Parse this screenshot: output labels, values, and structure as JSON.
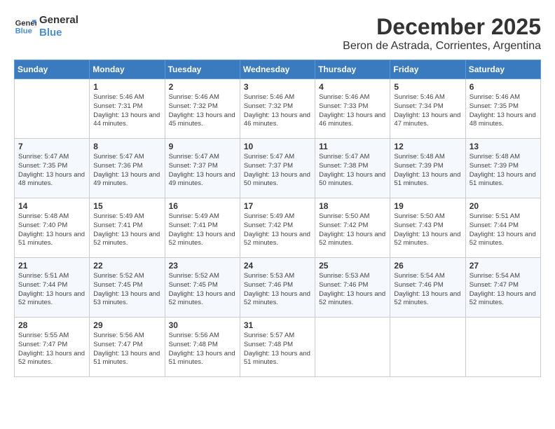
{
  "header": {
    "logo_line1": "General",
    "logo_line2": "Blue",
    "month": "December 2025",
    "location": "Beron de Astrada, Corrientes, Argentina"
  },
  "weekdays": [
    "Sunday",
    "Monday",
    "Tuesday",
    "Wednesday",
    "Thursday",
    "Friday",
    "Saturday"
  ],
  "weeks": [
    [
      {
        "day": "",
        "sunrise": "",
        "sunset": "",
        "daylight": ""
      },
      {
        "day": "1",
        "sunrise": "Sunrise: 5:46 AM",
        "sunset": "Sunset: 7:31 PM",
        "daylight": "Daylight: 13 hours and 44 minutes."
      },
      {
        "day": "2",
        "sunrise": "Sunrise: 5:46 AM",
        "sunset": "Sunset: 7:32 PM",
        "daylight": "Daylight: 13 hours and 45 minutes."
      },
      {
        "day": "3",
        "sunrise": "Sunrise: 5:46 AM",
        "sunset": "Sunset: 7:32 PM",
        "daylight": "Daylight: 13 hours and 46 minutes."
      },
      {
        "day": "4",
        "sunrise": "Sunrise: 5:46 AM",
        "sunset": "Sunset: 7:33 PM",
        "daylight": "Daylight: 13 hours and 46 minutes."
      },
      {
        "day": "5",
        "sunrise": "Sunrise: 5:46 AM",
        "sunset": "Sunset: 7:34 PM",
        "daylight": "Daylight: 13 hours and 47 minutes."
      },
      {
        "day": "6",
        "sunrise": "Sunrise: 5:46 AM",
        "sunset": "Sunset: 7:35 PM",
        "daylight": "Daylight: 13 hours and 48 minutes."
      }
    ],
    [
      {
        "day": "7",
        "sunrise": "Sunrise: 5:47 AM",
        "sunset": "Sunset: 7:35 PM",
        "daylight": "Daylight: 13 hours and 48 minutes."
      },
      {
        "day": "8",
        "sunrise": "Sunrise: 5:47 AM",
        "sunset": "Sunset: 7:36 PM",
        "daylight": "Daylight: 13 hours and 49 minutes."
      },
      {
        "day": "9",
        "sunrise": "Sunrise: 5:47 AM",
        "sunset": "Sunset: 7:37 PM",
        "daylight": "Daylight: 13 hours and 49 minutes."
      },
      {
        "day": "10",
        "sunrise": "Sunrise: 5:47 AM",
        "sunset": "Sunset: 7:37 PM",
        "daylight": "Daylight: 13 hours and 50 minutes."
      },
      {
        "day": "11",
        "sunrise": "Sunrise: 5:47 AM",
        "sunset": "Sunset: 7:38 PM",
        "daylight": "Daylight: 13 hours and 50 minutes."
      },
      {
        "day": "12",
        "sunrise": "Sunrise: 5:48 AM",
        "sunset": "Sunset: 7:39 PM",
        "daylight": "Daylight: 13 hours and 51 minutes."
      },
      {
        "day": "13",
        "sunrise": "Sunrise: 5:48 AM",
        "sunset": "Sunset: 7:39 PM",
        "daylight": "Daylight: 13 hours and 51 minutes."
      }
    ],
    [
      {
        "day": "14",
        "sunrise": "Sunrise: 5:48 AM",
        "sunset": "Sunset: 7:40 PM",
        "daylight": "Daylight: 13 hours and 51 minutes."
      },
      {
        "day": "15",
        "sunrise": "Sunrise: 5:49 AM",
        "sunset": "Sunset: 7:41 PM",
        "daylight": "Daylight: 13 hours and 52 minutes."
      },
      {
        "day": "16",
        "sunrise": "Sunrise: 5:49 AM",
        "sunset": "Sunset: 7:41 PM",
        "daylight": "Daylight: 13 hours and 52 minutes."
      },
      {
        "day": "17",
        "sunrise": "Sunrise: 5:49 AM",
        "sunset": "Sunset: 7:42 PM",
        "daylight": "Daylight: 13 hours and 52 minutes."
      },
      {
        "day": "18",
        "sunrise": "Sunrise: 5:50 AM",
        "sunset": "Sunset: 7:42 PM",
        "daylight": "Daylight: 13 hours and 52 minutes."
      },
      {
        "day": "19",
        "sunrise": "Sunrise: 5:50 AM",
        "sunset": "Sunset: 7:43 PM",
        "daylight": "Daylight: 13 hours and 52 minutes."
      },
      {
        "day": "20",
        "sunrise": "Sunrise: 5:51 AM",
        "sunset": "Sunset: 7:44 PM",
        "daylight": "Daylight: 13 hours and 52 minutes."
      }
    ],
    [
      {
        "day": "21",
        "sunrise": "Sunrise: 5:51 AM",
        "sunset": "Sunset: 7:44 PM",
        "daylight": "Daylight: 13 hours and 52 minutes."
      },
      {
        "day": "22",
        "sunrise": "Sunrise: 5:52 AM",
        "sunset": "Sunset: 7:45 PM",
        "daylight": "Daylight: 13 hours and 53 minutes."
      },
      {
        "day": "23",
        "sunrise": "Sunrise: 5:52 AM",
        "sunset": "Sunset: 7:45 PM",
        "daylight": "Daylight: 13 hours and 52 minutes."
      },
      {
        "day": "24",
        "sunrise": "Sunrise: 5:53 AM",
        "sunset": "Sunset: 7:46 PM",
        "daylight": "Daylight: 13 hours and 52 minutes."
      },
      {
        "day": "25",
        "sunrise": "Sunrise: 5:53 AM",
        "sunset": "Sunset: 7:46 PM",
        "daylight": "Daylight: 13 hours and 52 minutes."
      },
      {
        "day": "26",
        "sunrise": "Sunrise: 5:54 AM",
        "sunset": "Sunset: 7:46 PM",
        "daylight": "Daylight: 13 hours and 52 minutes."
      },
      {
        "day": "27",
        "sunrise": "Sunrise: 5:54 AM",
        "sunset": "Sunset: 7:47 PM",
        "daylight": "Daylight: 13 hours and 52 minutes."
      }
    ],
    [
      {
        "day": "28",
        "sunrise": "Sunrise: 5:55 AM",
        "sunset": "Sunset: 7:47 PM",
        "daylight": "Daylight: 13 hours and 52 minutes."
      },
      {
        "day": "29",
        "sunrise": "Sunrise: 5:56 AM",
        "sunset": "Sunset: 7:47 PM",
        "daylight": "Daylight: 13 hours and 51 minutes."
      },
      {
        "day": "30",
        "sunrise": "Sunrise: 5:56 AM",
        "sunset": "Sunset: 7:48 PM",
        "daylight": "Daylight: 13 hours and 51 minutes."
      },
      {
        "day": "31",
        "sunrise": "Sunrise: 5:57 AM",
        "sunset": "Sunset: 7:48 PM",
        "daylight": "Daylight: 13 hours and 51 minutes."
      },
      {
        "day": "",
        "sunrise": "",
        "sunset": "",
        "daylight": ""
      },
      {
        "day": "",
        "sunrise": "",
        "sunset": "",
        "daylight": ""
      },
      {
        "day": "",
        "sunrise": "",
        "sunset": "",
        "daylight": ""
      }
    ]
  ]
}
